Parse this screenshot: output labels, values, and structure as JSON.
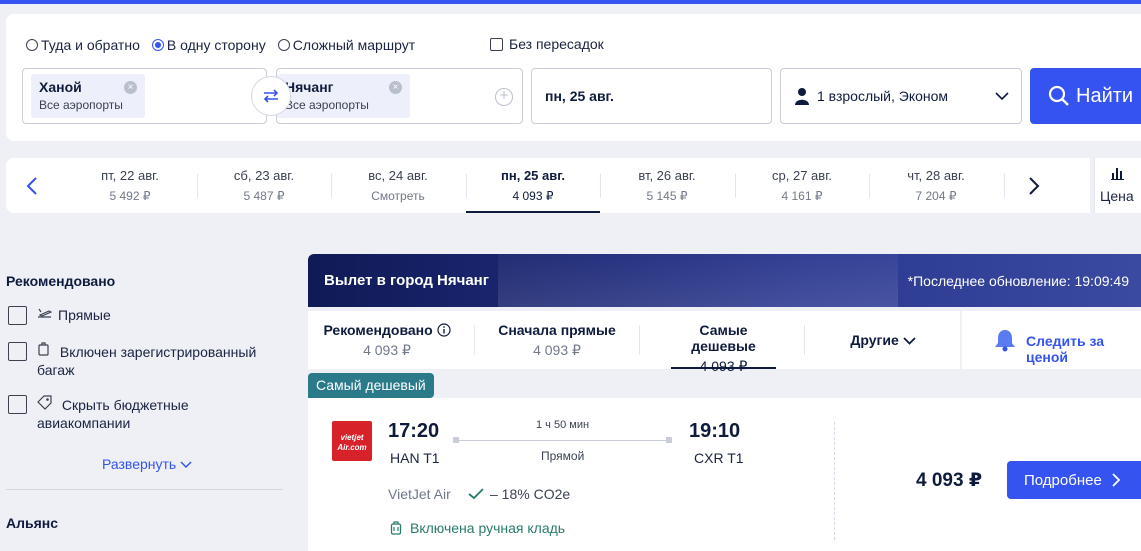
{
  "trip_types": [
    {
      "label": "Туда и обратно",
      "selected": false
    },
    {
      "label": "В одну сторону",
      "selected": true
    },
    {
      "label": "Сложный маршрут",
      "selected": false
    }
  ],
  "nonstop_label": "Без пересадок",
  "origin": {
    "city": "Ханой",
    "sub": "Все аэропорты"
  },
  "destination": {
    "city": "Нячанг",
    "sub": "Все аэропорты"
  },
  "date": "пн, 25 авг.",
  "passengers": "1 взрослый, Эконом",
  "search_button": "Найти",
  "date_strip": [
    {
      "date": "пт, 22 авг.",
      "price": "5 492 ₽",
      "active": false
    },
    {
      "date": "сб, 23 авг.",
      "price": "5 487 ₽",
      "active": false
    },
    {
      "date": "вс, 24 авг.",
      "price": "Смотреть",
      "active": false
    },
    {
      "date": "пн, 25 авг.",
      "price": "4 093 ₽",
      "active": true
    },
    {
      "date": "вт, 26 авг.",
      "price": "5 145 ₽",
      "active": false
    },
    {
      "date": "ср, 27 авг.",
      "price": "4 161 ₽",
      "active": false
    },
    {
      "date": "чт, 28 авг.",
      "price": "7 204 ₽",
      "active": false
    }
  ],
  "price_toggle_label": "Цена",
  "filters": {
    "title": "Рекомендовано",
    "items": [
      {
        "label": "Прямые"
      },
      {
        "label": "Включен зарегистрированный багаж"
      },
      {
        "label": "Скрыть бюджетные авиакомпании"
      }
    ],
    "expand_label": "Развернуть",
    "alliance_title": "Альянс"
  },
  "results_header": {
    "title": "Вылет в город Нячанг",
    "updated": "*Последнее обновление: 19:09:49"
  },
  "sort_tabs": [
    {
      "title": "Рекомендовано",
      "value": "4 093 ₽",
      "active": false
    },
    {
      "title": "Сначала прямые",
      "value": "4 093 ₽",
      "active": false
    },
    {
      "title": "Самые дешевые",
      "value": "4 093 ₽",
      "active": true
    }
  ],
  "sort_other_label": "Другие",
  "watch_price_label": "Следить за ценой",
  "cheapest_badge": "Самый дешевый",
  "flight": {
    "airline_logo_text": "vietjet Air.com",
    "depart_time": "17:20",
    "depart_airport": "HAN T1",
    "duration": "1 ч 50 мин",
    "stops": "Прямой",
    "arrive_time": "19:10",
    "arrive_airport": "CXR T1",
    "airline": "VietJet Air",
    "co2": "– 18% CO2e",
    "baggage": "Включена ручная кладь",
    "price": "4 093 ₽",
    "details_button": "Подробнее"
  },
  "colors": {
    "accent": "#3553f0",
    "badge": "#2a7a8a",
    "dark": "#0f1b3d"
  }
}
